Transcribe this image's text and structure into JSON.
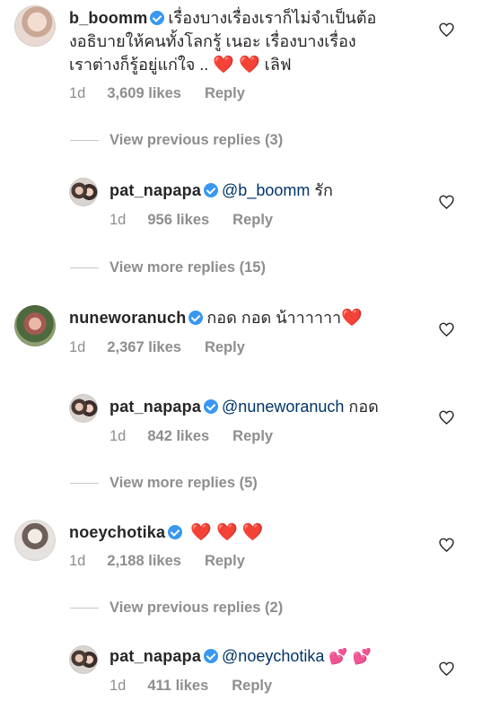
{
  "comments": [
    {
      "username": "b_boomm",
      "text_lines": [
        "เรื่องบางเรื่องเราก็ไม่จำเป็นต้อ",
        "งอธิบายให้คนทั้งโลกรู้ เนอะ เรื่องบางเรื่อง",
        "เราต่างก็รู้อยู่แก่ใจ .."
      ],
      "trailing_text": "เลิฟ",
      "age": "1d",
      "likes": "3,609 likes",
      "reply": "Reply",
      "view_replies": "View previous replies (3)",
      "reply_comment": {
        "username": "pat_napapa",
        "mention": "@b_boomm",
        "text": "รัก",
        "age": "1d",
        "likes": "956 likes",
        "reply": "Reply"
      },
      "view_more": "View more replies (15)"
    },
    {
      "username": "nuneworanuch",
      "text": "กอด กอด น้าาาาาา",
      "age": "1d",
      "likes": "2,367 likes",
      "reply": "Reply",
      "reply_comment": {
        "username": "pat_napapa",
        "mention": "@nuneworanuch",
        "text": "กอด",
        "age": "1d",
        "likes": "842 likes",
        "reply": "Reply"
      },
      "view_more": "View more replies (5)"
    },
    {
      "username": "noeychotika",
      "age": "1d",
      "likes": "2,188 likes",
      "reply": "Reply",
      "view_replies": "View previous replies (2)",
      "reply_comment": {
        "username": "pat_napapa",
        "mention": "@noeychotika",
        "age": "1d",
        "likes": "411 likes",
        "reply": "Reply"
      }
    }
  ],
  "icons": {
    "heart": "heart-outline-icon",
    "verified": "verified-badge-icon"
  },
  "colors": {
    "verified": "#3897f0",
    "mention": "#003569",
    "muted": "#8e8e8e"
  }
}
